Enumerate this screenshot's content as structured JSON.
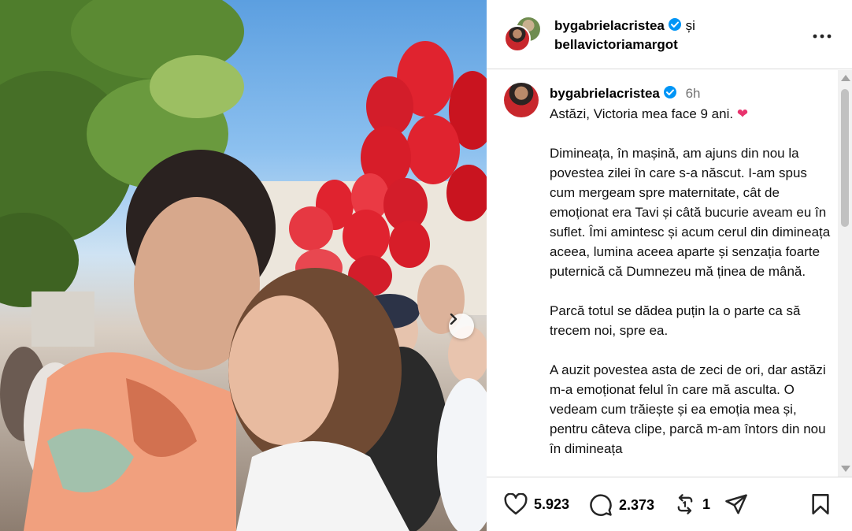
{
  "header": {
    "primary_user": "bygabrielacristea",
    "conjunction": "și",
    "collaborator": "bellavictoriamargot",
    "more_icon": "more-horizontal-icon"
  },
  "caption": {
    "username": "bygabrielacristea",
    "time": "6h",
    "first_line": "Astăzi, Victoria mea face 9 ani.",
    "emoji": "❤",
    "body": "Dimineața, în mașină, am ajuns din nou la povestea zilei în care s-a născut. I-am spus cum mergeam spre maternitate, cât de emoționat era Tavi și câtă bucurie aveam eu în suflet. Îmi amintesc și acum cerul din dimineața aceea, lumina aceea aparte și senzația foarte puternică că Dumnezeu mă ținea de mână.\n\nParcă totul se dădea puțin la o parte ca să trecem noi, spre ea.\n\nA auzit povestea asta de zeci de ori, dar astăzi m-a emoționat felul în care mă asculta. O vedeam cum trăiește și ea emoția mea și, pentru câteva clipe, parcă m-am întors din nou în dimineața"
  },
  "actions": {
    "likes": "5.923",
    "comments": "2.373",
    "reposts": "1"
  },
  "colors": {
    "verified": "#0095f6",
    "divider": "#dbdbdb",
    "time": "#737373",
    "balloon": "#e0232f"
  }
}
